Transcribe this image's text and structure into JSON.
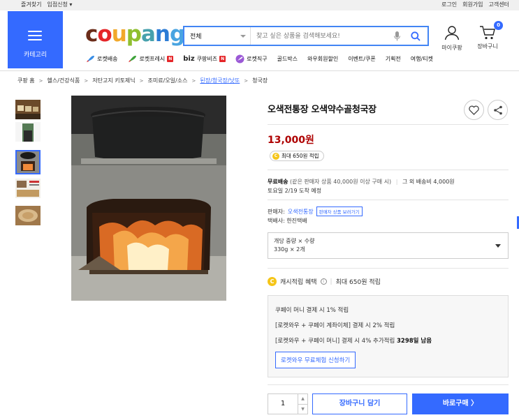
{
  "topbar": {
    "bookmark": "즐겨찾기",
    "entry": "입점신청 ▾",
    "login": "로그인",
    "join": "회원가입",
    "cs": "고객센터"
  },
  "category": {
    "label": "카테고리"
  },
  "logo": {
    "letters": [
      "c",
      "o",
      "u",
      "p",
      "a",
      "n",
      "g"
    ],
    "colors": [
      "#6b2d1a",
      "#e52528",
      "#f1a82b",
      "#8fbf2f",
      "#47a1ad",
      "#2c7cd5",
      "#49a4e1"
    ]
  },
  "search": {
    "scope": "전체",
    "placeholder": "찾고 싶은 상품을 검색해보세요!"
  },
  "header": {
    "mypage": "마이쿠팡",
    "cart": "장바구니",
    "cart_count": "0"
  },
  "nav": [
    {
      "label": "로켓배송",
      "icon": "rocket-icon"
    },
    {
      "label": "로켓프레시",
      "icon": "rocket-fresh-icon",
      "new": "N"
    },
    {
      "label": "쿠팡비즈",
      "prefix": "biz",
      "new": "N"
    },
    {
      "label": "로켓직구",
      "icon": "rocket-global-icon"
    },
    {
      "label": "골드박스"
    },
    {
      "label": "와우회원할인"
    },
    {
      "label": "이벤트/쿠폰"
    },
    {
      "label": "기획전"
    },
    {
      "label": "여행/티켓"
    }
  ],
  "breadcrumb": [
    "쿠팡 홈",
    "헬스/건강식품",
    "저탄고지 키토제닉",
    "조미료/오일/소스",
    "된장/청국장/낫또",
    "청국장"
  ],
  "product": {
    "title": "오색전통장 오색약수골청국장",
    "price": "13,000원",
    "reward": "최대 650원 적립",
    "ship_free": "무료배송",
    "ship_cond": "(같은 판매자 상품 40,000원 이상 구매 시)",
    "ship_other": "그 외 배송비 4,000원",
    "arrival": "토요일 2/19 도착 예정",
    "seller_label": "판매자:",
    "seller_name": "오색전통장",
    "seller_btn": "판매자 상품 보러가기",
    "courier": "택배사: 한진택배",
    "option_label": "개당 중량 × 수량",
    "option_value": "330g × 2개",
    "cash_label": "캐시적립 혜택",
    "cash_value": "최대 650원 적립",
    "benefit1": "쿠페이 머니 결제 시 1% 적립",
    "benefit2": "[로켓와우 + 쿠페이 계좌이체] 결제 시 2% 적립",
    "benefit3": "[로켓와우 + 쿠페이 머니] 결제 시 4% 추가적립",
    "benefit3_days": "3298일 남음",
    "trial_btn": "로켓와우 무료체험 신청하기",
    "qty": "1",
    "cart_btn": "장바구니 담기",
    "buy_btn": "바로구매 〉"
  }
}
